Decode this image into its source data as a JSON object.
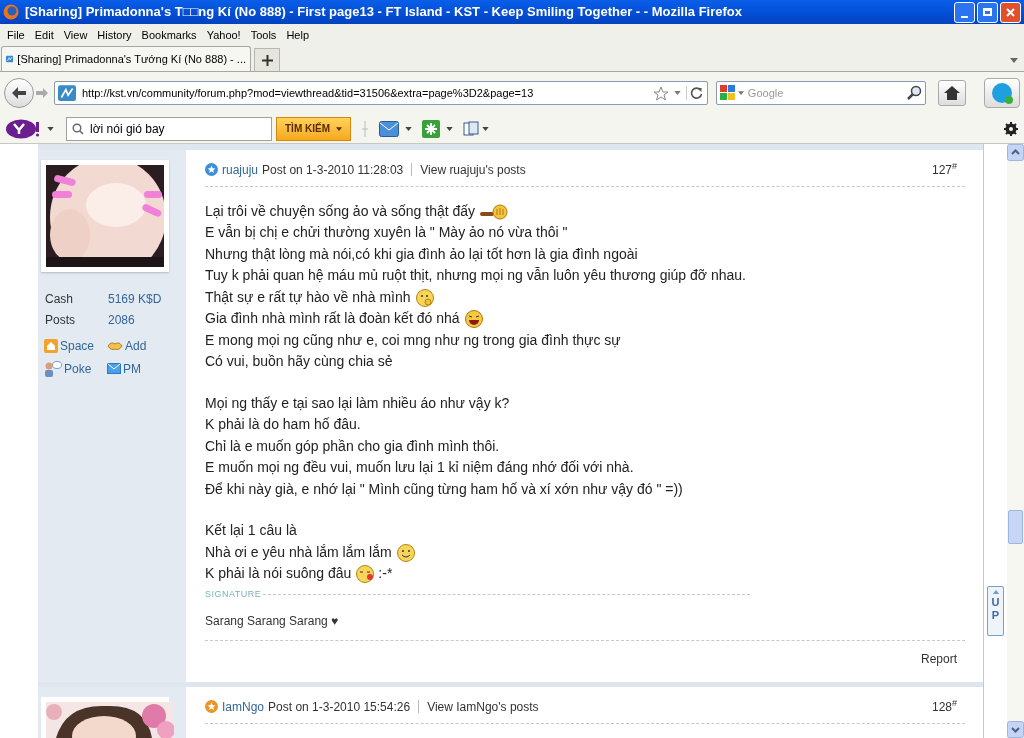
{
  "window": {
    "title": "[Sharing] Primadonna's T□□ng Kí (No 888) - First page13 - FT Island - KST - Keep Smiling Together - - Mozilla Firefox"
  },
  "menu": [
    "File",
    "Edit",
    "View",
    "History",
    "Bookmarks",
    "Yahoo!",
    "Tools",
    "Help"
  ],
  "tabs": [
    {
      "label": "[Sharing] Primadonna's Tướng Kí (No 888) - ...",
      "selected": true
    }
  ],
  "address": {
    "value": "http://kst.vn/community/forum.php?mod=viewthread&tid=31506&extra=page%3D2&page=13"
  },
  "search": {
    "placeholder": "Google"
  },
  "yahoo_toolbar": {
    "search_value": "lời nói gió bay",
    "search_button": "TÌM KIẾM"
  },
  "posts": [
    {
      "author": "ruajuju",
      "color": "#3b8fd6",
      "posted": "Post on 1-3-2010 11:28:03",
      "view_link": "View ruajuju's posts",
      "number": "127$^{#}$",
      "stats": [
        {
          "label": "Cash",
          "value": "5169 K$D"
        },
        {
          "label": "Posts",
          "value": "2086"
        }
      ],
      "actions": [
        {
          "kind": "space",
          "label": "Space"
        },
        {
          "kind": "add",
          "label": "Add"
        },
        {
          "kind": "poke",
          "label": "Poke"
        },
        {
          "kind": "pm",
          "label": "PM"
        }
      ],
      "paragraphs": [
        [
          {
            "text": "Lại trôi về chuyện sống ảo và sống thật đấy",
            "kind": "wave"
          },
          {
            "text": "E vẫn bị chị e chửi thường xuyên là \" Mày ảo nó vừa thôi \""
          },
          {
            "text": "Nhưng thật lòng mà nói,có khi gia đình ảo lại tốt hơn là gia đình ngoài"
          },
          {
            "text": "Tuy k phải quan hệ máu mủ ruột thịt, nhưng mọi ng vẫn luôn yêu thương giúp đỡ nhau."
          },
          {
            "text": "Thật sự e rất tự hào về nhà mình",
            "kind": "thinking"
          },
          {
            "text": "Gia đình nhà mình rất là đoàn kết đó nhá",
            "kind": "laugh"
          },
          {
            "text": "E mong mọi ng cũng như e, coi mng như ng trong gia đình thực sự"
          },
          {
            "text": "Có vui, buồn hãy cùng chia sẻ"
          }
        ],
        [
          {
            "text": "Mọi ng thấy e tại sao lại làm nhiều áo như vậy k?"
          },
          {
            "text": "K phải là do ham hố đâu."
          },
          {
            "text": "Chỉ là e muốn góp phần cho gia đình mình thôi."
          },
          {
            "text": "E muốn mọi ng đều vui, muốn lưu lại 1 kỉ niệm đáng nhớ đối với nhà."
          },
          {
            "text": "Để khi này già, e nhớ lại \" Mình cũng từng ham hố và xí xớn như vậy đó \" =))"
          }
        ],
        [
          {
            "text": "Kết lại 1 câu là"
          },
          {
            "text": "Nhà ơi e yêu nhà lắm lắm lắm",
            "kind": "smile"
          },
          {
            "text": "K phải là nói suông đâu",
            "kind": "kiss",
            "after": ":-*"
          }
        ]
      ],
      "signature_label": "SIGNATURE",
      "signature": "Sarang Sarang Sarang ♥",
      "report": "Report"
    },
    {
      "author": "IamNgo",
      "color": "#e8962a",
      "posted": "Post on 1-3-2010 15:54:26",
      "view_link": "View IamNgo's posts",
      "number": "128$^{#}$"
    }
  ],
  "up_button": "UP"
}
